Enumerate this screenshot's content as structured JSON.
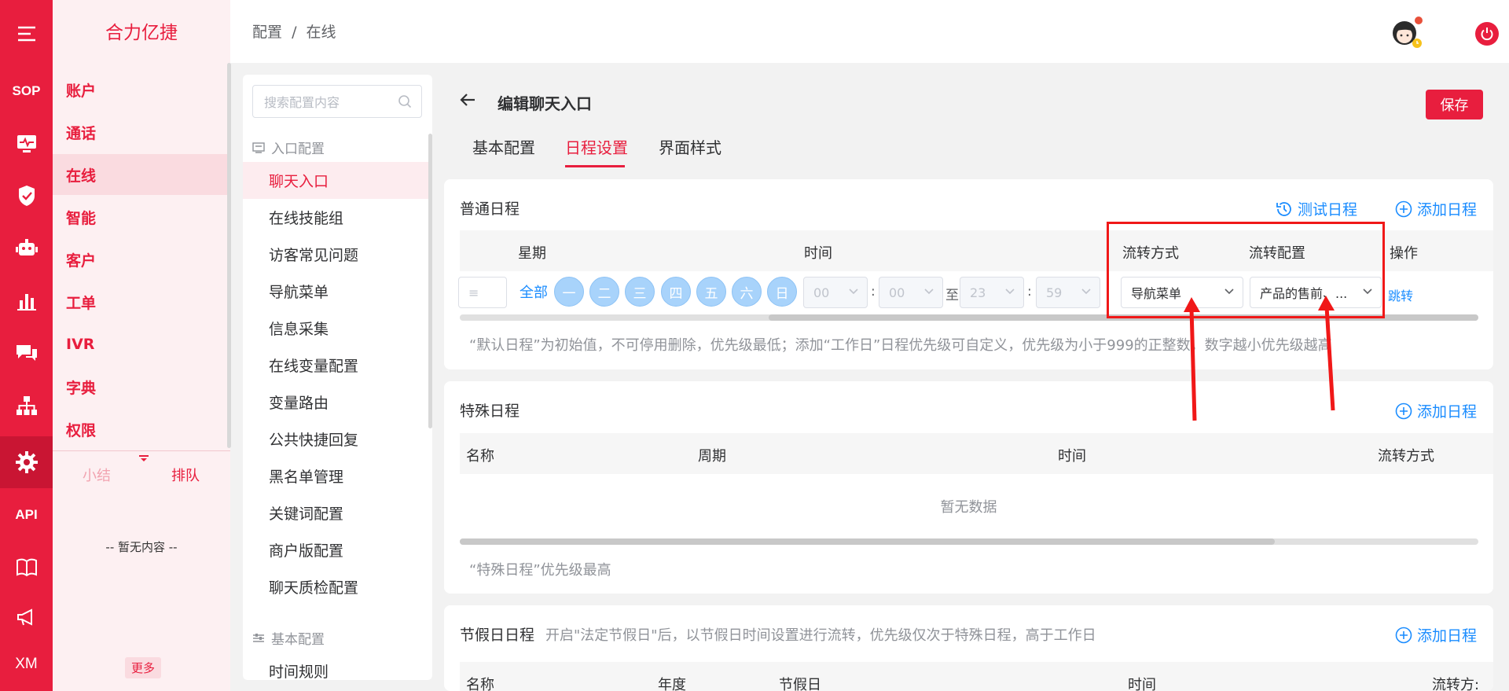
{
  "rail": [
    {
      "name": "menu-icon",
      "text": ""
    },
    {
      "name": "sop-icon",
      "text": "SOP"
    },
    {
      "name": "monitor-icon",
      "text": ""
    },
    {
      "name": "shield-icon",
      "text": ""
    },
    {
      "name": "robot-icon",
      "text": ""
    },
    {
      "name": "chart-icon",
      "text": ""
    },
    {
      "name": "chat-icon",
      "text": ""
    },
    {
      "name": "org-icon",
      "text": ""
    },
    {
      "name": "gear-icon",
      "text": ""
    },
    {
      "name": "api-icon",
      "text": "API"
    },
    {
      "name": "book-icon",
      "text": ""
    },
    {
      "name": "megaphone-icon",
      "text": ""
    },
    {
      "name": "xm-icon",
      "text": "XM"
    }
  ],
  "brand": "合力亿捷",
  "nav": {
    "items": [
      "账户",
      "通话",
      "在线",
      "智能",
      "客户",
      "工单",
      "IVR",
      "字典",
      "权限"
    ],
    "active_index": 2,
    "tabs": [
      "小结",
      "排队"
    ],
    "empty_text": "-- 暂无内容 --",
    "more": "更多"
  },
  "breadcrumb": [
    "配置",
    "/",
    "在线"
  ],
  "config_menu": {
    "search_placeholder": "搜索配置内容",
    "group1": "入口配置",
    "items": [
      "聊天入口",
      "在线技能组",
      "访客常见问题",
      "导航菜单",
      "信息采集",
      "在线变量配置",
      "变量路由",
      "公共快捷回复",
      "黑名单管理",
      "关键词配置",
      "商户版配置",
      "聊天质检配置"
    ],
    "active_index": 0,
    "group2": "基本配置",
    "items2": [
      "时间规则"
    ]
  },
  "page": {
    "title": "编辑聊天入口",
    "save": "保存",
    "tabs": [
      "基本配置",
      "日程设置",
      "界面样式"
    ],
    "active_tab": 1
  },
  "normal_schedule": {
    "title": "普通日程",
    "test_btn": "测试日程",
    "add_btn": "添加日程",
    "headers": {
      "week": "星期",
      "time": "时间",
      "flow_mode": "流转方式",
      "flow_config": "流转配置",
      "op": "操作"
    },
    "all_label": "全部",
    "days": [
      "一",
      "二",
      "三",
      "四",
      "五",
      "六",
      "日"
    ],
    "time": {
      "h1": "00",
      "m1": "00",
      "to": "至",
      "h2": "23",
      "m2": "59",
      "colon": ":"
    },
    "flow_mode_value": "导航菜单",
    "flow_config_value": "产品的售前、...",
    "op_link": "跳转",
    "hint": "“默认日程”为初始值，不可停用删除，优先级最低；添加“工作日”日程优先级可自定义，优先级为小于999的正整数，数字越小优先级越高"
  },
  "special_schedule": {
    "title": "特殊日程",
    "add_btn": "添加日程",
    "headers": [
      "名称",
      "周期",
      "时间",
      "流转方式"
    ],
    "empty": "暂无数据",
    "hint": "“特殊日程”优先级最高"
  },
  "holiday_schedule": {
    "title": "节假日日程",
    "subtitle": "开启\"法定节假日\"后，以节假日时间设置进行流转，优先级仅次于特殊日程，高于工作日",
    "add_btn": "添加日程",
    "headers": [
      "名称",
      "年度",
      "节假日",
      "时间",
      "流转方:"
    ]
  },
  "colors": {
    "brand": "#e81e3e",
    "link": "#1a8cff",
    "annotation": "#f01818"
  }
}
